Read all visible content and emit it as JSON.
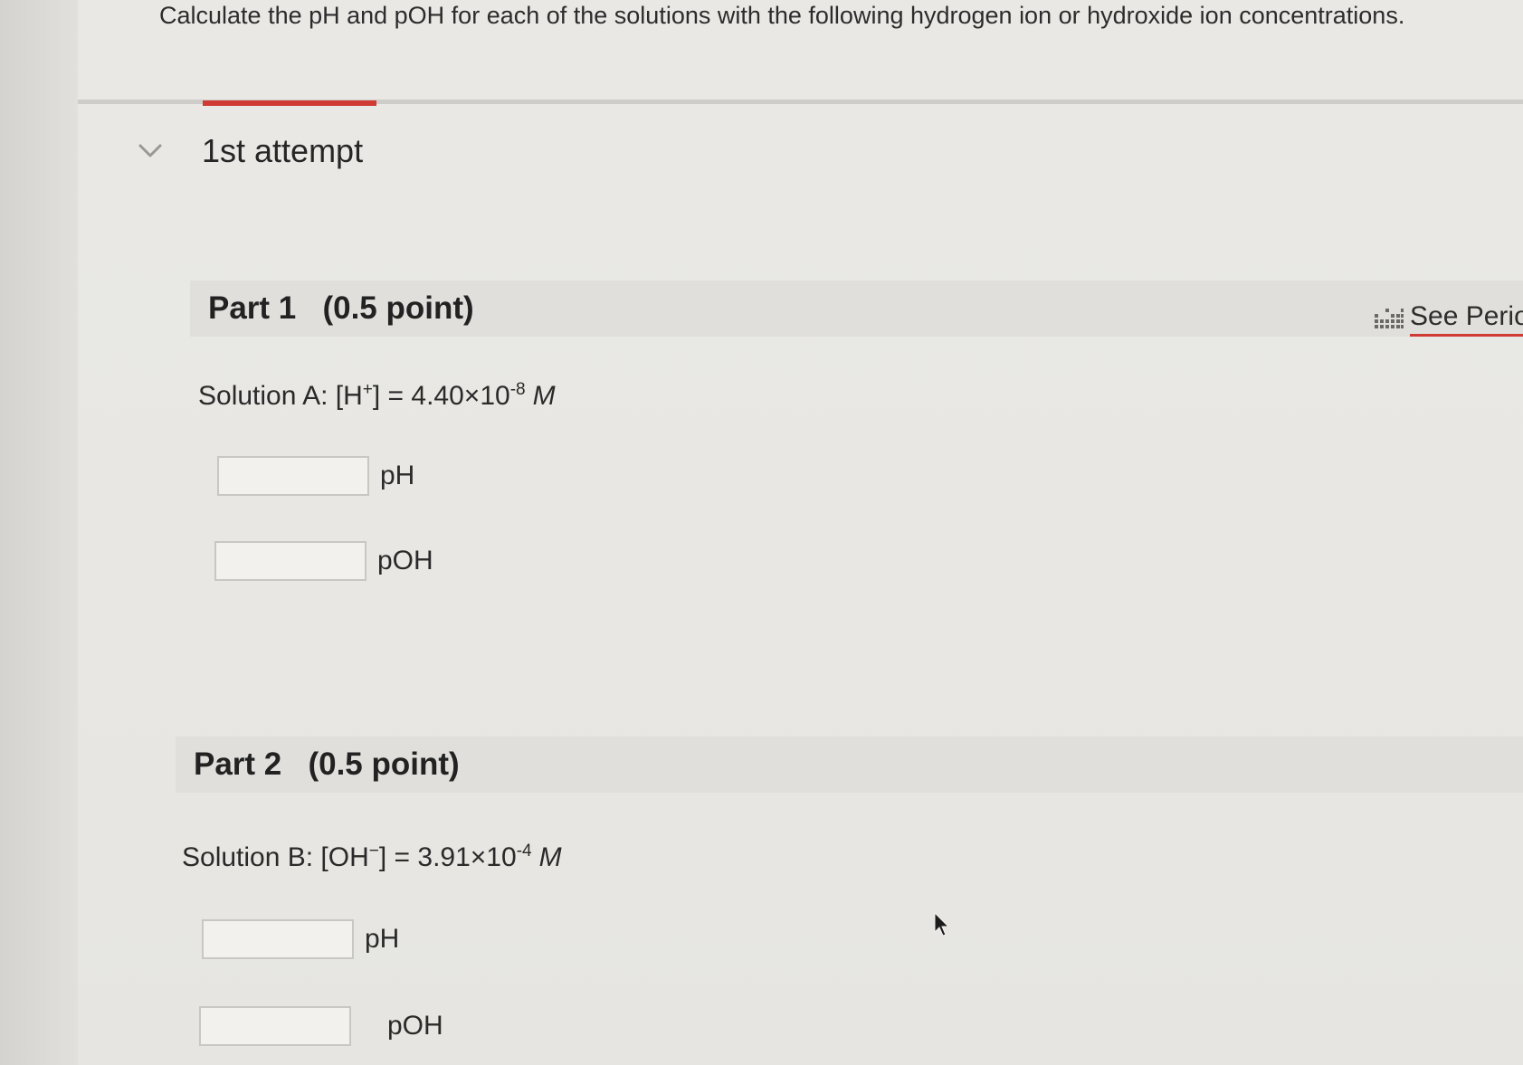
{
  "question": {
    "instruction": "Calculate the pH and pOH for each of the solutions with the following hydrogen ion or hydroxide ion concentrations."
  },
  "attempt": {
    "label": "1st attempt"
  },
  "periodic_table_link": {
    "label": "See Perio"
  },
  "parts": [
    {
      "title": "Part 1   (0.5 point)",
      "solution": {
        "prefix": "Solution A:  [H",
        "ion_charge": "+",
        "middle": "] = 4.40×10",
        "exponent": "-8",
        "unit": "M"
      },
      "fields": [
        {
          "value": "",
          "unit": "pH"
        },
        {
          "value": "",
          "unit": "pOH"
        }
      ]
    },
    {
      "title": "Part 2   (0.5 point)",
      "solution": {
        "prefix": "Solution B: [OH",
        "ion_charge": "−",
        "middle": "] = 3.91×10",
        "exponent": "-4",
        "unit": "M"
      },
      "fields": [
        {
          "value": "",
          "unit": "pH"
        },
        {
          "value": "",
          "unit": "pOH"
        }
      ]
    }
  ],
  "colors": {
    "accent": "#cf3a34",
    "background": "#e8e7e3"
  }
}
